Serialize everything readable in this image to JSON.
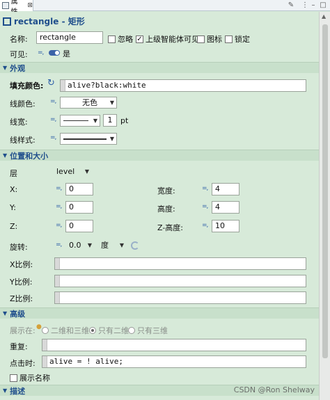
{
  "tab": {
    "label": "属性",
    "close": "⊠"
  },
  "title": "rectangle - 矩形",
  "header": {
    "name_label": "名称:",
    "name_value": "rectangle",
    "ignore": "忽略",
    "parent_visible": "上级智能体可见",
    "icon": "图标",
    "lock": "锁定",
    "visible_label": "可见:",
    "visible_value": "是"
  },
  "appearance": {
    "section": "外观",
    "fill_label": "填充颜色:",
    "fill_value": "alive?black:white",
    "line_color_label": "线颜色:",
    "line_color_value": "无色",
    "line_width_label": "线宽:",
    "line_width_value": "1",
    "line_width_unit": "pt",
    "line_style_label": "线样式:"
  },
  "position": {
    "section": "位置和大小",
    "layer_label": "层",
    "layer_value": "level",
    "x_label": "X:",
    "x_value": "0",
    "y_label": "Y:",
    "y_value": "0",
    "z_label": "Z:",
    "z_value": "0",
    "width_label": "宽度:",
    "width_value": "4",
    "height_label": "高度:",
    "height_value": "4",
    "zheight_label": "Z-高度:",
    "zheight_value": "10",
    "rotation_label": "旋转:",
    "rotation_value": "0.0",
    "rotation_unit": "度",
    "xscale_label": "X比例:",
    "yscale_label": "Y比例:",
    "zscale_label": "Z比例:"
  },
  "advanced": {
    "section": "高级",
    "show_in_label": "展示在:",
    "opt_2d3d": "二维和三维",
    "opt_2d": "只有二维",
    "opt_3d": "只有三维",
    "repeat_label": "重复:",
    "click_label": "点击时:",
    "click_value": "alive = ! alive;",
    "show_name": "展示名称"
  },
  "description": {
    "section": "描述"
  },
  "watermark": "CSDN @Ron Shelway",
  "icons": [
    "properties-icon",
    "close-icon",
    "toolbar-icons",
    "dynamic-value-icon",
    "toggle-icon",
    "radio-icons"
  ]
}
